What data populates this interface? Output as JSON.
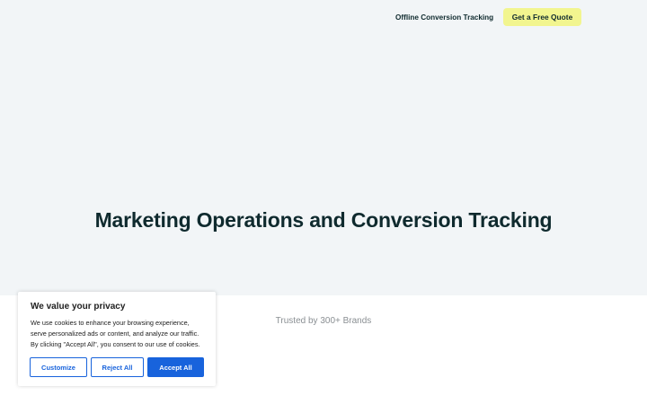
{
  "header": {
    "nav_link": "Offline Conversion Tracking",
    "cta_label": "Get a Free Quote"
  },
  "hero": {
    "title": "Marketing Operations and Conversion Tracking"
  },
  "trusted": {
    "text": "Trusted by 300+ Brands"
  },
  "cookie_banner": {
    "title": "We value your privacy",
    "lines": [
      "We use cookies to enhance your browsing experience,",
      "serve personalized ads or content, and analyze our traffic.",
      "By clicking \"Accept All\", you consent to our use of cookies."
    ],
    "customize_label": "Customize",
    "reject_label": "Reject All",
    "accept_label": "Accept All"
  },
  "colors": {
    "hero_bg": "#f2f5f7",
    "cta_bg": "#f2f58f",
    "accent_blue": "#1863dc",
    "heading": "#0f2a2e"
  }
}
